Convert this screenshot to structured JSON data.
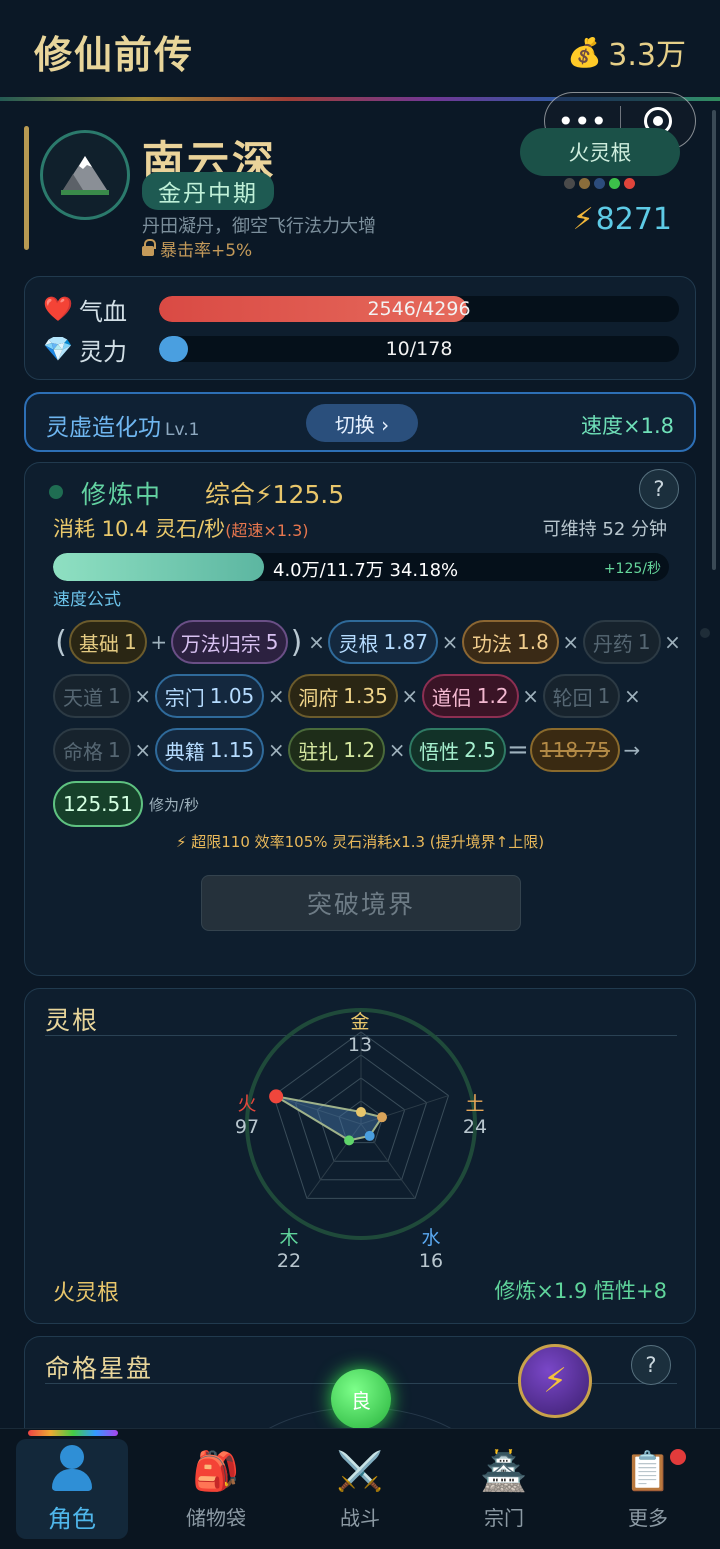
{
  "header": {
    "app_title": "修仙前传",
    "money_icon": "money-bag-icon",
    "money": "3.3万"
  },
  "profile": {
    "name": "南云深",
    "realm": "金丹中期",
    "description": "丹田凝丹，御空飞行法力大增",
    "locked_bonus": "暴击率+5%",
    "root_badge": "火灵根",
    "power": "8271",
    "element_dots": [
      "#4a4a4a",
      "#8a6d3b",
      "#2c4c7c",
      "#3cc04a",
      "#e0443b"
    ]
  },
  "stats": {
    "hp_label": "气血",
    "hp_text": "2546/4296",
    "hp_fraction": 0.593,
    "mp_label": "灵力",
    "mp_text": "10/178",
    "mp_fraction": 0.056
  },
  "skill": {
    "name": "灵虚造化功",
    "level": "Lv.1",
    "switch_label": "切换 ›",
    "speed": "速度×1.8"
  },
  "cultivation": {
    "status": "修炼中",
    "total": "综合⚡125.5",
    "consume": "消耗 10.4 灵石/秒",
    "consume_note": "(超速×1.3)",
    "sustain": "可维持 52 分钟",
    "progress_text": "4.0万/11.7万  34.18%",
    "progress_fraction": 0.3418,
    "rate": "+125/秒",
    "formula_label": "速度公式",
    "factors": {
      "base": {
        "name": "基础",
        "value": "1"
      },
      "wanfa": {
        "name": "万法归宗",
        "value": "5"
      },
      "linggen": {
        "name": "灵根",
        "value": "1.87"
      },
      "gongfa": {
        "name": "功法",
        "value": "1.8"
      },
      "danyao": {
        "name": "丹药",
        "value": "1"
      },
      "tiandao": {
        "name": "天道",
        "value": "1"
      },
      "zongmen": {
        "name": "宗门",
        "value": "1.05"
      },
      "dongfu": {
        "name": "洞府",
        "value": "1.35"
      },
      "daolv": {
        "name": "道侣",
        "value": "1.2"
      },
      "lunhui": {
        "name": "轮回",
        "value": "1"
      },
      "mingge": {
        "name": "命格",
        "value": "1"
      },
      "dianji": {
        "name": "典籍",
        "value": "1.15"
      },
      "zhuzha": {
        "name": "驻扎",
        "value": "1.2"
      },
      "wuxing": {
        "name": "悟性",
        "value": "2.5"
      }
    },
    "old_result": "118.75",
    "result": "125.51",
    "result_unit": "修为/秒",
    "hint": "⚡ 超限110 效率105% 灵石消耗x1.3 (提升境界↑上限)",
    "breakthrough_label": "突破境界"
  },
  "spirit_roots": {
    "title": "灵根",
    "gold_label": "金",
    "gold_value": "13",
    "earth_label": "土",
    "earth_value": "24",
    "water_label": "水",
    "water_value": "16",
    "wood_label": "木",
    "wood_value": "22",
    "fire_label": "火",
    "fire_value": "97",
    "values": {
      "gold": 13,
      "earth": 24,
      "water": 16,
      "wood": 22,
      "fire": 97
    },
    "root_name": "火灵根",
    "bonus": "修炼×1.9  悟性+8"
  },
  "fate": {
    "title": "命格星盘",
    "grade": "良"
  },
  "nav": {
    "items": [
      {
        "label": "角色",
        "icon": "character-icon"
      },
      {
        "label": "储物袋",
        "icon": "backpack-icon"
      },
      {
        "label": "战斗",
        "icon": "crossed-swords-icon"
      },
      {
        "label": "宗门",
        "icon": "pagoda-icon"
      },
      {
        "label": "更多",
        "icon": "clipboard-icon"
      }
    ]
  }
}
